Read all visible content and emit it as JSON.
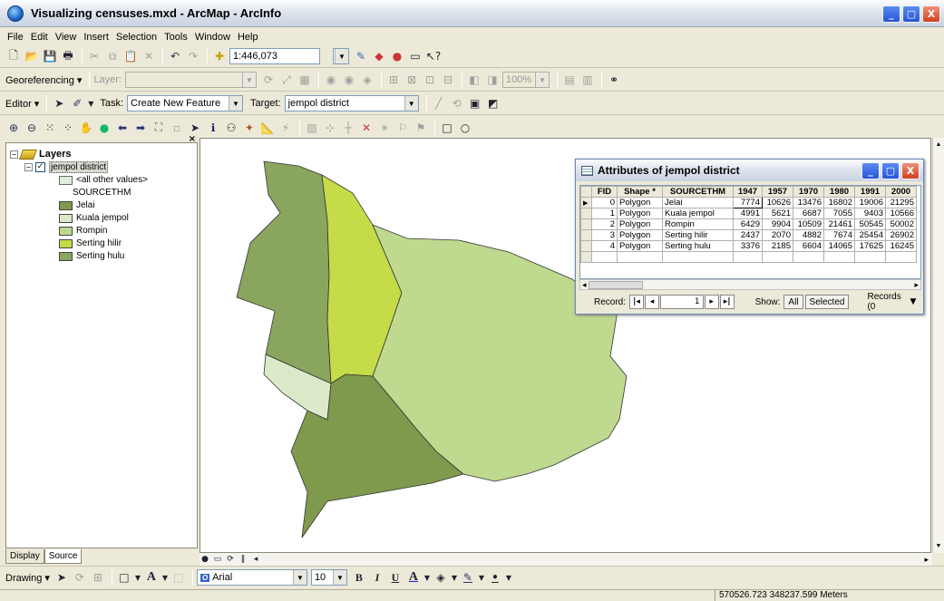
{
  "window": {
    "title": "Visualizing censuses.mxd - ArcMap - ArcInfo",
    "min": "_",
    "max": "▢",
    "close": "X"
  },
  "menu": [
    "File",
    "Edit",
    "View",
    "Insert",
    "Selection",
    "Tools",
    "Window",
    "Help"
  ],
  "standard_toolbar": {
    "scale": "1:446,073"
  },
  "georef_toolbar": {
    "label": "Georeferencing ▾",
    "layer_label": "Layer:",
    "zoom": "100%"
  },
  "editor_toolbar": {
    "editor": "Editor ▾",
    "task_label": "Task:",
    "task": "Create New Feature",
    "target_label": "Target:",
    "target": "jempol district"
  },
  "toc": {
    "layers_label": "Layers",
    "layer_name": "jempol district",
    "all_other": "<all other values>",
    "field": "SOURCETHM",
    "classes": [
      {
        "label": "Jelai",
        "color": "#7f9a4c"
      },
      {
        "label": "Kuala jempol",
        "color": "#dbe9c8"
      },
      {
        "label": "Rompin",
        "color": "#bfd98f"
      },
      {
        "label": "Serting hilir",
        "color": "#c5db48"
      },
      {
        "label": "Serting hulu",
        "color": "#8aa55e"
      }
    ],
    "tabs": [
      "Display",
      "Source"
    ]
  },
  "attr": {
    "title": "Attributes of jempol district",
    "columns": [
      "FID",
      "Shape *",
      "SOURCETHM",
      "1947",
      "1957",
      "1970",
      "1980",
      "1991",
      "2000"
    ],
    "rows": [
      [
        "0",
        "Polygon",
        "Jelai",
        "7774",
        "10626",
        "13476",
        "16802",
        "19006",
        "21295"
      ],
      [
        "1",
        "Polygon",
        "Kuala jempol",
        "4991",
        "5621",
        "6687",
        "7055",
        "9403",
        "10566"
      ],
      [
        "2",
        "Polygon",
        "Rompin",
        "6429",
        "9904",
        "10509",
        "21461",
        "50545",
        "50002"
      ],
      [
        "3",
        "Polygon",
        "Serting hilir",
        "2437",
        "2070",
        "4882",
        "7674",
        "25454",
        "26902"
      ],
      [
        "4",
        "Polygon",
        "Serting hulu",
        "3376",
        "2185",
        "6604",
        "14065",
        "17625",
        "16245"
      ]
    ],
    "record_label": "Record:",
    "record_value": "1",
    "show_label": "Show:",
    "show_all": "All",
    "show_selected": "Selected",
    "records_text": "Records (0"
  },
  "drawing_toolbar": {
    "label": "Drawing ▾",
    "font": "Arial",
    "size": "10"
  },
  "status": {
    "coords": "570526.723  348237.599 Meters"
  }
}
